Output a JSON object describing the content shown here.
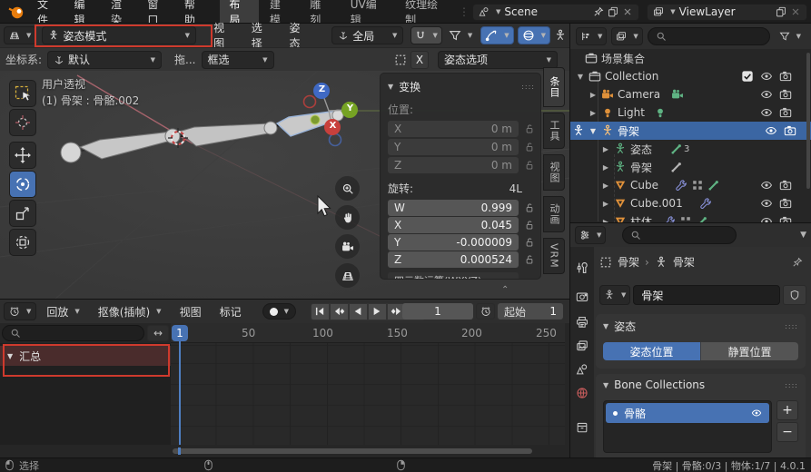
{
  "colors": {
    "accent_blue": "#4772b3",
    "annotation_red": "#cf3a2d",
    "selection_row": "#3b66a3",
    "summary_row": "#4a2c2c",
    "mesh_orange": "#e0913a",
    "data_green": "#5fb383",
    "wrench_blue": "#8a93dd"
  },
  "topbar": {
    "menus": [
      "文件",
      "编辑",
      "渲染",
      "窗口",
      "帮助"
    ],
    "workspaces": [
      "布局",
      "建模",
      "雕刻",
      "UV编辑",
      "纹理绘制"
    ],
    "active_workspace": "布局",
    "scene_value": "Scene",
    "view_layer_value": "ViewLayer"
  },
  "viewport": {
    "mode": "姿态模式",
    "menus": [
      "视图",
      "选择",
      "姿态"
    ],
    "orientation": "全局",
    "tool_settings": {
      "coord_label": "坐标系:",
      "coord_value": "默认",
      "drag_label": "拖...",
      "drag_value": "框选",
      "mirror_x": "X",
      "pose_options": "姿态选项"
    },
    "overlay": {
      "view_label": "用户透视",
      "object_label": "(1) 骨架 : 骨骼.002"
    },
    "axis_gizmo": {
      "x": "X",
      "y": "Y",
      "z": "Z"
    }
  },
  "n_panel": {
    "tabs": [
      "条目",
      "工具",
      "视图",
      "动画",
      "VRM"
    ],
    "active_tab": "条目",
    "title": "变换",
    "location_label": "位置:",
    "location": [
      {
        "axis": "X",
        "value": "0 m"
      },
      {
        "axis": "Y",
        "value": "0 m"
      },
      {
        "axis": "Z",
        "value": "0 m"
      }
    ],
    "rotation_label": "旋转:",
    "rotation_badge": "4L",
    "rotation": [
      {
        "axis": "W",
        "value": "0.999"
      },
      {
        "axis": "X",
        "value": "0.045"
      },
      {
        "axis": "Y",
        "value": "-0.000009"
      },
      {
        "axis": "Z",
        "value": "0.000524"
      }
    ],
    "rotation_mode": "四元数运算(WXYZ)"
  },
  "outliner": {
    "rows": [
      {
        "label": "场景集合"
      },
      {
        "label": "Collection"
      },
      {
        "label": "Camera"
      },
      {
        "label": "Light"
      },
      {
        "label": "骨架"
      },
      {
        "label": "姿态",
        "badge": "3"
      },
      {
        "label": "骨架"
      },
      {
        "label": "Cube"
      },
      {
        "label": "Cube.001"
      },
      {
        "label": "柱体"
      }
    ]
  },
  "properties": {
    "breadcrumb": {
      "object": "骨架",
      "data": "骨架"
    },
    "name_value": "骨架",
    "pose_panel": {
      "title": "姿态",
      "pose_position": "姿态位置",
      "rest_position": "静置位置"
    },
    "bone_collections": {
      "title": "Bone Collections",
      "items": [
        {
          "name": "骨骼"
        }
      ],
      "add": "+",
      "remove": "−"
    }
  },
  "timeline": {
    "menus": [
      "回放",
      "抠像(插帧)",
      "视图",
      "标记"
    ],
    "current_frame": "1",
    "start_label": "起始",
    "start_value": "1",
    "playhead_label": "1",
    "ruler_ticks": [
      "50",
      "100",
      "150",
      "200",
      "250"
    ],
    "summary_label": "汇总"
  },
  "statusbar": {
    "left": "选择",
    "right": "骨架 | 骨骼:0/3 | 物体:1/7 | 4.0.1"
  }
}
